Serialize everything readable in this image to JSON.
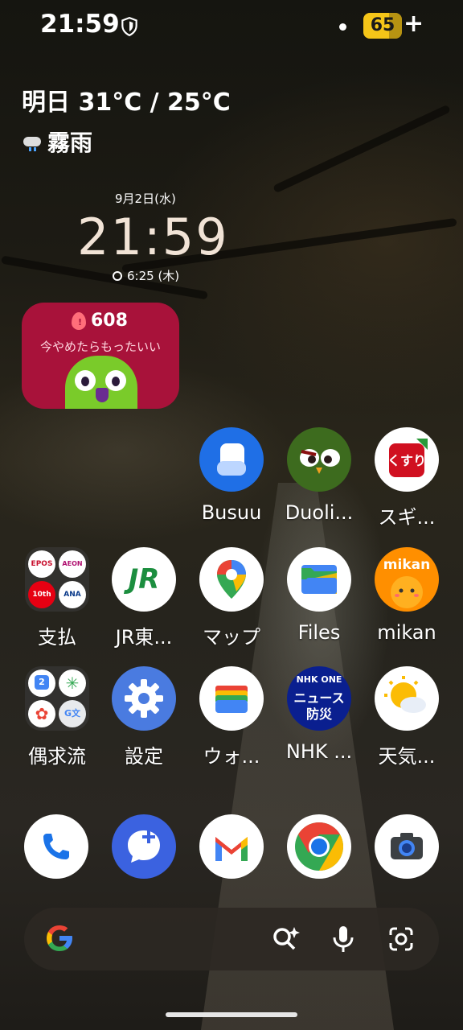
{
  "status_bar": {
    "time": "21:59",
    "battery": "65",
    "battery_suffix": "+"
  },
  "weather": {
    "temperature": "明日 31°C / 25°C",
    "condition": "霧雨"
  },
  "clock": {
    "date": "9月2日(水)",
    "time": "21:59",
    "alarm": "6:25 (木)"
  },
  "duolingo_widget": {
    "streak": "608",
    "message": "今やめたらもったいい"
  },
  "apps": {
    "row1": [
      {
        "name": "busuu",
        "label": "Busuu"
      },
      {
        "name": "duolingo",
        "label": "Duoli..."
      },
      {
        "name": "sugi",
        "label": "スギ..."
      }
    ],
    "row2": [
      {
        "name": "payment-folder",
        "label": "支払",
        "mini": [
          "EPOS",
          "AEON",
          "10th",
          "ANA"
        ]
      },
      {
        "name": "jr-east",
        "label": "JR東...",
        "logo": "JR"
      },
      {
        "name": "maps",
        "label": "マップ"
      },
      {
        "name": "files",
        "label": "Files"
      },
      {
        "name": "mikan",
        "label": "mikan",
        "logo": "mikan"
      }
    ],
    "row3": [
      {
        "name": "misc-folder",
        "label": "偶求流"
      },
      {
        "name": "settings",
        "label": "設定"
      },
      {
        "name": "wallet",
        "label": "ウォ..."
      },
      {
        "name": "nhk",
        "label": "NHK ...",
        "logo_line1": "NHK ONE",
        "logo_line2": "ニュース",
        "logo_line3": "防災"
      },
      {
        "name": "weather",
        "label": "天気..."
      }
    ]
  },
  "dock": [
    "phone",
    "messages",
    "gmail",
    "chrome",
    "camera"
  ],
  "colors": {
    "battery": "#f5c518",
    "duo_widget": "#a8123a",
    "busuu": "#1f6fe6",
    "jr": "#1c8e3f",
    "nhk": "#0a1f8f",
    "mikan": "#ff8f00"
  }
}
